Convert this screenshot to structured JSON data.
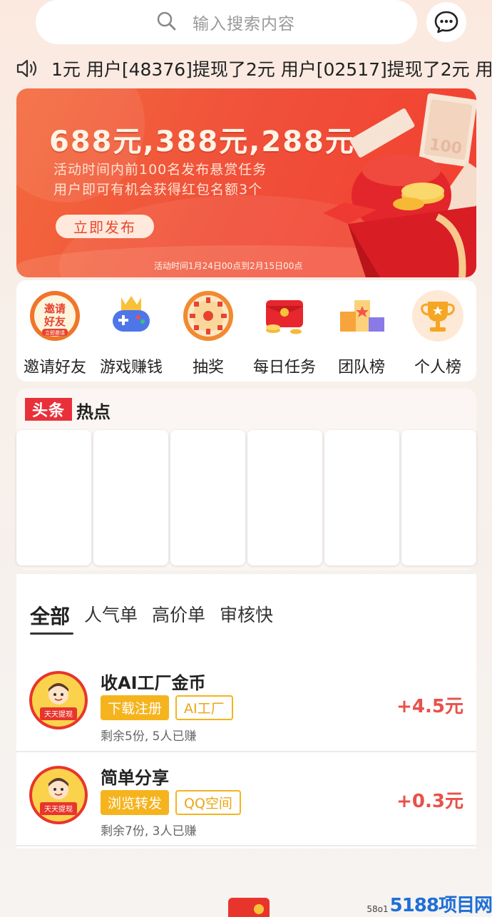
{
  "search": {
    "placeholder": "输入搜索内容"
  },
  "marquee": {
    "text": "1元 用户[48376]提现了2元 用户[02517]提现了2元 用"
  },
  "banner": {
    "title": "688元,388元,288元",
    "desc_line1": "活动时间内前100名发布悬赏任务",
    "desc_line2": "用户即可有机会获得红包名额3个",
    "button": "立即发布",
    "time": "活动时间1月24日00点到2月15日00点",
    "badge_text": "100"
  },
  "grid": [
    {
      "label": "邀请好友",
      "icon": "invite-friend-icon",
      "badge_line1": "邀请",
      "badge_line2": "好友",
      "badge_sub": "立即邀请"
    },
    {
      "label": "游戏赚钱",
      "icon": "game-controller-icon"
    },
    {
      "label": "抽奖",
      "icon": "lottery-wheel-icon"
    },
    {
      "label": "每日任务",
      "icon": "red-envelope-icon"
    },
    {
      "label": "团队榜",
      "icon": "podium-icon"
    },
    {
      "label": "个人榜",
      "icon": "trophy-icon"
    }
  ],
  "headline": {
    "logo": "头条",
    "title": "热点"
  },
  "tabs": [
    "全部",
    "人气单",
    "高价单",
    "审核快"
  ],
  "tasks": [
    {
      "title": "收AI工厂金币",
      "tag1": "下载注册",
      "tag2": "AI工厂",
      "meta": "剩余5份, 5人已赚",
      "reward": "+4.5元",
      "avatar_text": "天天提现"
    },
    {
      "title": "简单分享",
      "tag1": "浏览转发",
      "tag2": "QQ空间",
      "meta": "剩余7份, 3人已赚",
      "reward": "+0.3元",
      "avatar_text": "天天提现"
    }
  ],
  "watermark": {
    "small": "58o1",
    "big": "5188项目网"
  },
  "colors": {
    "accent": "#f0513a",
    "tag": "#f5b41e",
    "reward": "#e8514a"
  }
}
